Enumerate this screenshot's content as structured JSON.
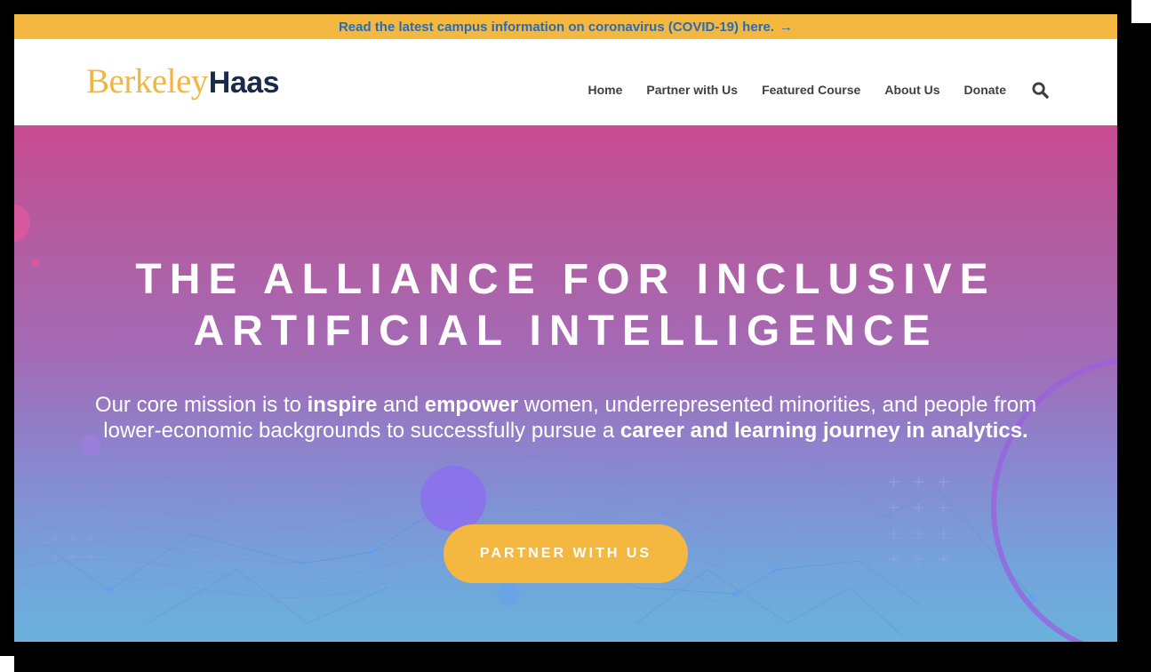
{
  "alert": {
    "text": "Read the latest campus information on coronavirus (COVID-19) here.",
    "arrow": "→"
  },
  "logo": {
    "part1": "Berkeley",
    "part2": "Haas"
  },
  "nav": {
    "items": [
      "Home",
      "Partner with Us",
      "Featured Course",
      "About Us",
      "Donate"
    ],
    "search_icon": "search-icon"
  },
  "hero": {
    "title_line1": "THE ALLIANCE FOR INCLUSIVE",
    "title_line2": "ARTIFICIAL INTELLIGENCE",
    "mission": {
      "t1": "Our core mission is to ",
      "b1": "inspire",
      "t2": " and ",
      "b2": "empower",
      "t3": " women, underrepresented minorities, and people from lower-economic backgrounds to successfully pursue a ",
      "b3": "career and learning journey in analytics."
    },
    "cta_label": "PARTNER WITH US"
  },
  "colors": {
    "alert_bg": "#f4b841",
    "alert_text": "#2b6bb3",
    "logo_gold": "#f0b641",
    "logo_navy": "#1a2a4a",
    "hero_top": "#c94b92",
    "hero_bottom": "#6ab1db",
    "cta_bg": "#f4b841"
  }
}
